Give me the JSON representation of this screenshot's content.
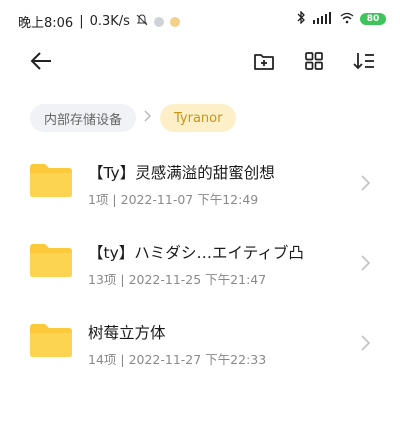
{
  "status_bar": {
    "time": "晚上8:06",
    "network_speed": "0.3K/s",
    "battery": "80",
    "battery_color": "#3ec45a"
  },
  "toolbar": {
    "back_icon": "back-arrow-icon",
    "new_folder_icon": "new-folder-icon",
    "grid_view_icon": "grid-view-icon",
    "sort_icon": "sort-icon"
  },
  "breadcrumb": {
    "root": "内部存储设备",
    "current": "Tyranor",
    "accent_color": "#c89514"
  },
  "files": [
    {
      "name": "【Ty】灵感满溢的甜蜜创想",
      "meta": "1项 | 2022-11-07 下午12:49"
    },
    {
      "name": "【ty】ハミダシ…エイティブ凸",
      "meta": "13项 | 2022-11-25 下午21:47"
    },
    {
      "name": "树莓立方体",
      "meta": "14项 | 2022-11-27 下午22:33"
    }
  ],
  "folder_color": "#fcc93a"
}
